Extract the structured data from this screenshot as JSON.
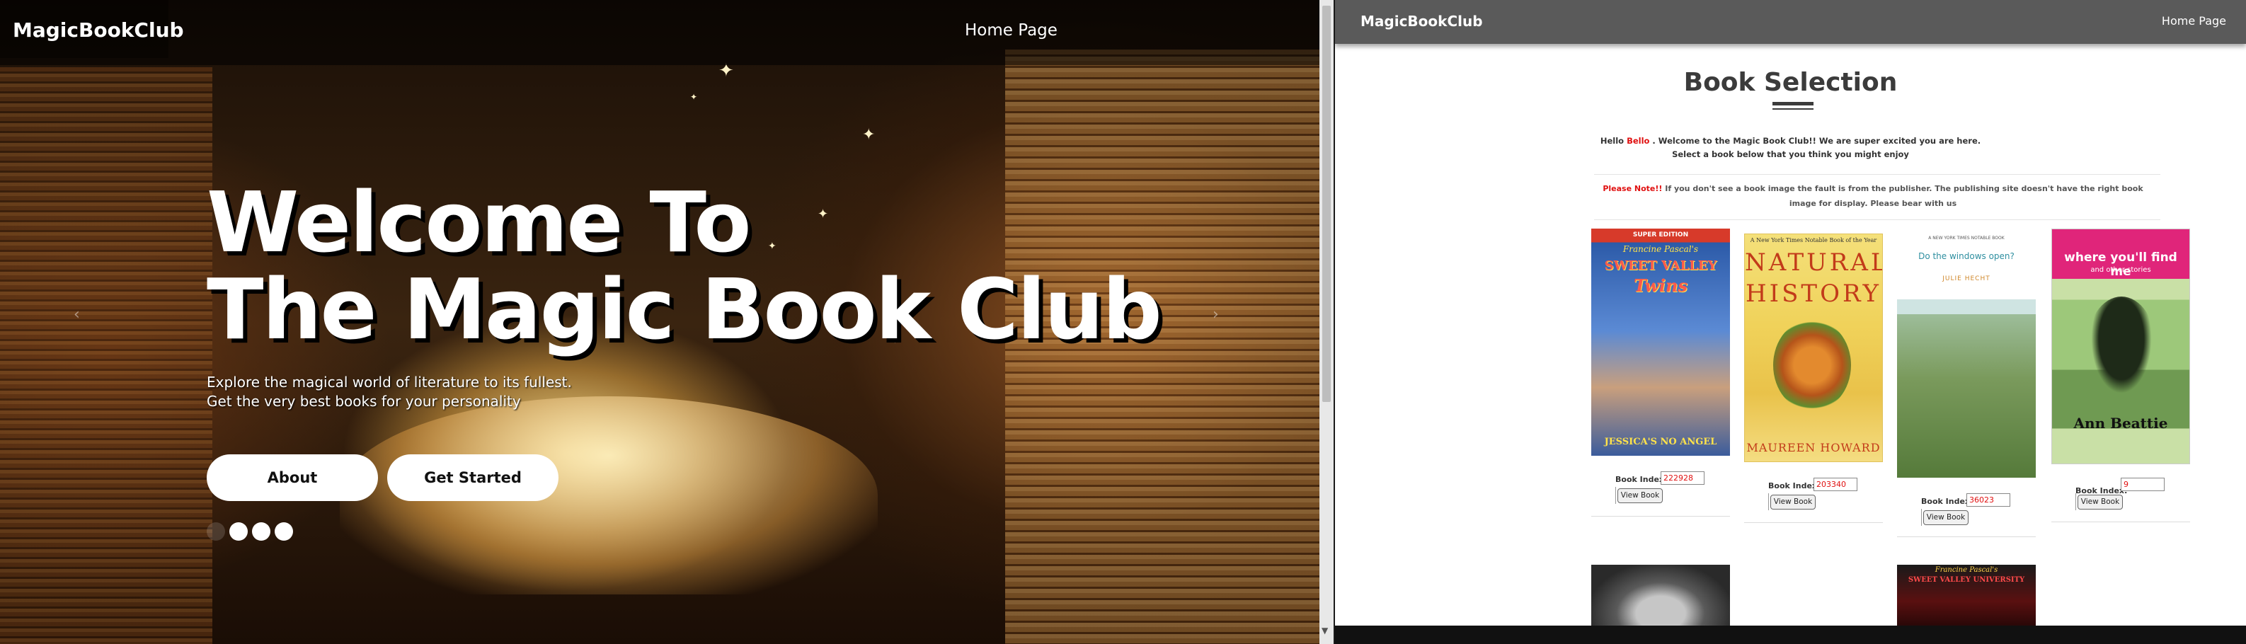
{
  "hero": {
    "brand": "MagicBookClub",
    "nav_home": "Home Page",
    "title_line1": "Welcome To",
    "title_line2": "The Magic Book Club",
    "subtitle_line1": "Explore the magical world of literature to its fullest.",
    "subtitle_line2": "Get the very best books for your personality",
    "about_button": "About",
    "get_started_button": "Get Started",
    "carousel_prev_icon": "‹",
    "carousel_next_icon": "›",
    "carousel_slides": 3
  },
  "selection": {
    "brand": "MagicBookClub",
    "nav_home": "Home Page",
    "title": "Book Selection",
    "greeting_prefix": "Hello ",
    "user_name": "Bello",
    "greeting_suffix": " . Welcome to the Magic Book Club!! We are super excited you are here.",
    "greeting_line2": "Select a book below that you think you might enjoy",
    "note_label": "Please Note!!",
    "note_text": " If you don't see a book image the fault is from the publisher. The publishing site doesn't have the right book image for display. Please bear with us",
    "book_index_label": "Book Index:",
    "view_button": "View Book",
    "books": [
      {
        "index": "222928",
        "cover": {
          "top": "SUPER EDITION",
          "author": "Francine Pascal's",
          "title1": "SWEET VALLEY",
          "title2": "Twins",
          "bottom": "JESSICA'S NO ANGEL"
        }
      },
      {
        "index": "203340",
        "cover": {
          "top": "A New York Times Notable Book of the Year",
          "title1": "NATURAL",
          "title2": "HISTORY",
          "bottom": "MAUREEN HOWARD"
        }
      },
      {
        "index": "36023",
        "cover": {
          "top": "A NEW YORK TIMES NOTABLE BOOK",
          "title1": "Do the windows open?",
          "author": "JULIE HECHT"
        }
      },
      {
        "index": "9",
        "cover": {
          "title1": "where you'll find me",
          "title2": "and other stories",
          "author": "Ann Beattie"
        }
      }
    ],
    "partial_covers": [
      {
        "author": "Francine Pascal's",
        "title": "SWEET VALLEY UNIVERSITY"
      }
    ]
  },
  "colors": {
    "accent_red": "#e01010",
    "navbar_gray": "#5a5a5a",
    "title_gray": "#3b3b3b"
  }
}
